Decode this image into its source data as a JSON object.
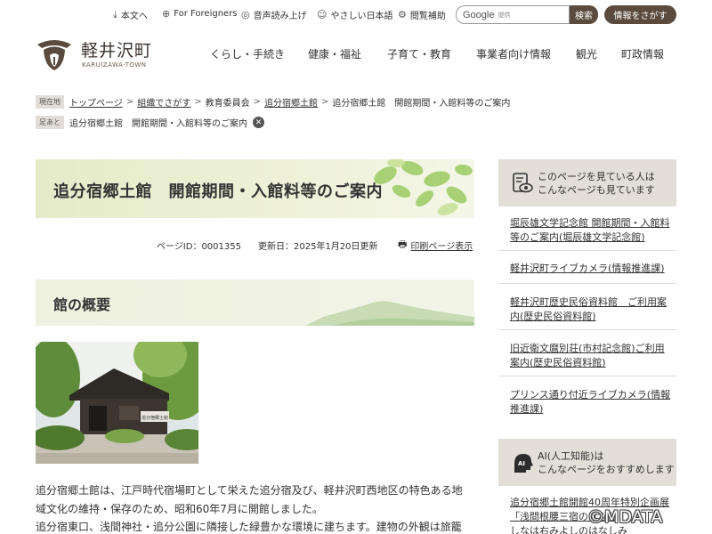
{
  "utility": {
    "items": [
      {
        "label": "本文へ",
        "icon": "arrow-down-icon"
      },
      {
        "label": "For Foreigners",
        "icon": "globe-icon"
      },
      {
        "label": "音声読み上げ",
        "icon": "speaker-icon"
      },
      {
        "label": "やさしい日本語",
        "icon": "smile-icon"
      },
      {
        "label": "閲覧補助",
        "icon": "gear-icon"
      }
    ],
    "search_brand": "Google",
    "search_brand_note": "提供",
    "search_button": "検索",
    "info_button": "情報をさがす"
  },
  "header": {
    "logo_name": "軽井沢町",
    "logo_sub": "KARUIZAWA-TOWN",
    "nav": [
      "くらし・手続き",
      "健康・福祉",
      "子育て・教育",
      "事業者向け情報",
      "観光",
      "町政情報"
    ]
  },
  "breadcrumb": {
    "tag": "現在地",
    "links": [
      "トップページ",
      "組織でさがす",
      "教育委員会",
      "追分宿郷土館"
    ],
    "middle_plain": "教育委員会",
    "current": "追分宿郷土館　開館期間・入館料等のご案内"
  },
  "history": {
    "tag": "足あと",
    "item": "追分宿郷土館　開館期間・入館料等のご案内"
  },
  "main": {
    "title": "追分宿郷土館　開館期間・入館料等のご案内",
    "page_id": "ページID：0001355",
    "updated": "更新日：2025年1月20日更新",
    "print": "印刷ページ表示",
    "section_title": "館の概要",
    "paragraphs": [
      "追分宿郷土館は、江戸時代宿場町として栄えた追分宿及び、軽井沢町西地区の特色ある地",
      "域文化の維持・保存のため、昭和60年7月に開館しました。",
      "追分宿東口、浅間神社・追分公園に隣接した緑豊かな環境に建ちます。建物の外観は旅籠"
    ],
    "photo_sign": "追分宿郷土館"
  },
  "sidebar": {
    "box1": {
      "line1": "このページを見ている人は",
      "line2": "こんなページも見ています"
    },
    "links": [
      [
        "堀辰雄文学記念館 開館期間・入館料",
        "等のご案内(堀辰雄文学記念館)"
      ],
      [
        "軽井沢町ライブカメラ(情報推進課)"
      ],
      [
        "軽井沢町歴史民俗資料館　ご利用案",
        "内(歴史民俗資料館)"
      ],
      [
        "旧近衛文麿別荘(市村記念館)ご利用",
        "案内(歴史民俗資料館)"
      ],
      [
        "プリンス通り付近ライブカメラ(情報",
        "推進課)"
      ]
    ],
    "box2": {
      "line1": "AI(人工知能)は",
      "line2": "こんなページをおすすめします",
      "badge": "AI"
    },
    "ai_links": [
      "追分宿郷土館開館40周年特別企画展",
      "「浅間根腰三宿のはなし",
      "しなは右みよしのはなしみ"
    ]
  },
  "watermark": "©MDATA",
  "colors": {
    "brown": "#5a4b3e",
    "green_band": "#e5ebc9",
    "side_box": "#e3ded7"
  }
}
